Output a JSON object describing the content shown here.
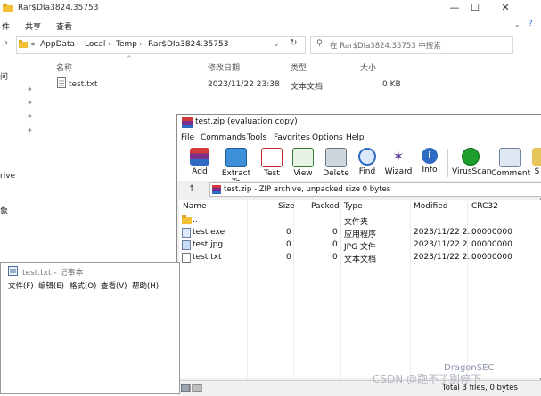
{
  "explorer": {
    "title": "Rar$DIa3824.35753",
    "ribbon_tabs": [
      "件",
      "共享",
      "查看"
    ],
    "address": {
      "lead": "«",
      "crumbs": [
        "AppData",
        "Local",
        "Temp",
        "Rar$DIa3824.35753"
      ]
    },
    "search_placeholder": "在 Rar$DIa3824.35753 中搜索",
    "nav_items": [
      "问",
      "rive",
      "象"
    ],
    "columns": [
      "名称",
      "修改日期",
      "类型",
      "大小"
    ],
    "files": [
      {
        "name": "test.txt",
        "modified": "2023/11/22 23:38",
        "type": "文本文档",
        "size": "0 KB"
      }
    ]
  },
  "winrar": {
    "title": "test.zip (evaluation copy)",
    "menu": [
      "File",
      "Commands",
      "Tools",
      "Favorites",
      "Options",
      "Help"
    ],
    "toolbar": [
      "Add",
      "Extract To",
      "Test",
      "View",
      "Delete",
      "Find",
      "Wizard",
      "Info",
      "VirusScan",
      "Comment",
      "S"
    ],
    "path": "test.zip - ZIP archive, unpacked size 0 bytes",
    "columns": [
      "Name",
      "Size",
      "Packed",
      "Type",
      "Modified",
      "CRC32"
    ],
    "rows": [
      {
        "name": "..",
        "size": "",
        "packed": "",
        "type": "文件夹",
        "modified": "",
        "crc": ""
      },
      {
        "name": "test.exe",
        "size": "0",
        "packed": "0",
        "type": "应用程序",
        "modified": "2023/11/22 2...",
        "crc": "00000000"
      },
      {
        "name": "test.jpg",
        "size": "0",
        "packed": "0",
        "type": "JPG 文件",
        "modified": "2023/11/22 2...",
        "crc": "00000000"
      },
      {
        "name": "test.txt",
        "size": "0",
        "packed": "0",
        "type": "文本文档",
        "modified": "2023/11/22 2...",
        "crc": "00000000"
      }
    ],
    "status": "Total 3 files, 0 bytes"
  },
  "notepad": {
    "title": "test.txt - 记事本",
    "menu": [
      "文件(F)",
      "编辑(E)",
      "格式(O)",
      "查看(V)",
      "帮助(H)"
    ]
  },
  "watermark": {
    "brand": "DragonSEC",
    "csdn": "CSDN @跑不了别停下"
  },
  "colors": {
    "folder": "#f2c037",
    "accent": "#0078d7",
    "rar_purple": "#7b2e8e",
    "virus_green": "#1e9e2e"
  }
}
